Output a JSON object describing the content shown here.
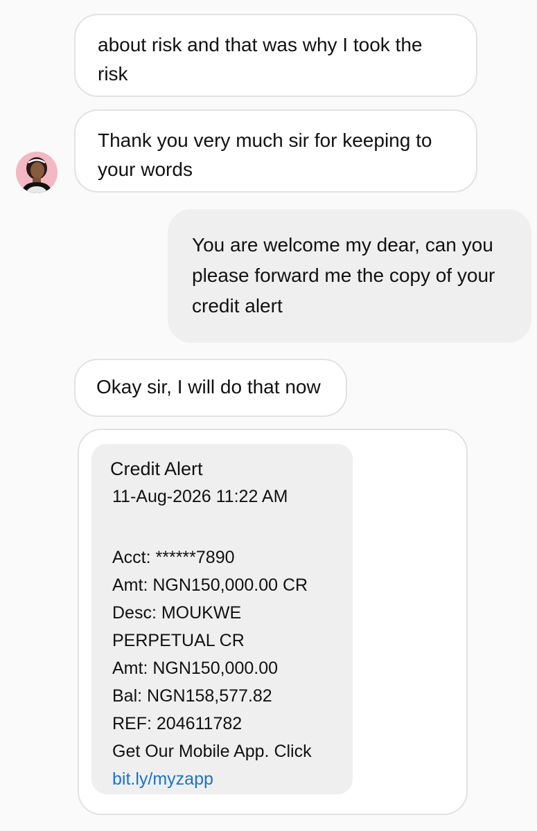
{
  "conversation": {
    "messages": [
      {
        "direction": "incoming",
        "text": "about risk and that was why I took the risk"
      },
      {
        "direction": "incoming",
        "text": "Thank you very much sir for keeping to your words"
      },
      {
        "direction": "outgoing",
        "text": "You are welcome my dear, can you please forward me the copy of your credit alert"
      },
      {
        "direction": "incoming",
        "text": "Okay sir, I will do that now"
      }
    ],
    "credit_alert": {
      "title": "Credit Alert",
      "datetime": "11-Aug-2026 11:22 AM",
      "acct": "Acct: ******7890",
      "amt_cr": "Amt: NGN150,000.00 CR",
      "desc": "Desc: MOUKWE PERPETUAL CR",
      "amt": "Amt: NGN150,000.00",
      "bal": "Bal: NGN158,577.82",
      "ref": "REF: 204611782",
      "promo": "Get Our Mobile App. Click",
      "link": "bit.ly/myzapp"
    }
  },
  "colors": {
    "background": "#fafafa",
    "incoming_bubble": "#ffffff",
    "incoming_border": "#e2e2e2",
    "outgoing_bubble": "#efefef",
    "link": "#1a73c9"
  },
  "icons": {
    "avatar": "user-avatar-photo"
  }
}
